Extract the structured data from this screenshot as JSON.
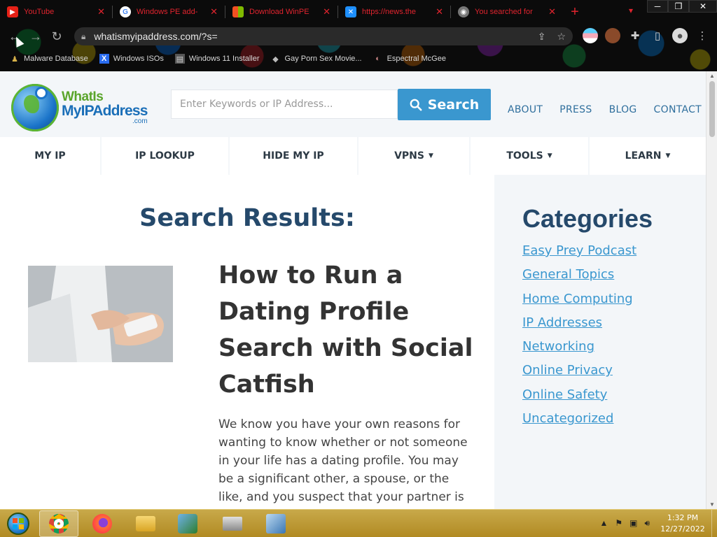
{
  "browser": {
    "tabs": [
      {
        "title": "YouTube",
        "fav_color": "#e62117",
        "fav": "▶"
      },
      {
        "title": "Windows PE add-",
        "fav_color": "#ffffff",
        "fav": "G"
      },
      {
        "title": "Download WinPE",
        "fav_color": "#f25022",
        "fav": "■"
      },
      {
        "title": "https://news.the",
        "fav_color": "#1e90ff",
        "fav": "✕"
      },
      {
        "title": "You searched for",
        "fav_color": "#888888",
        "fav": "◉"
      }
    ],
    "url": "whatismyipaddress.com/?s=",
    "bookmarks": [
      {
        "label": "Malware Database",
        "icon": "♟"
      },
      {
        "label": "Windows ISOs",
        "icon": "X"
      },
      {
        "label": "Windows 11 Installer",
        "icon": "▤"
      },
      {
        "label": "Gay Porn Sex Movie...",
        "icon": "◆"
      },
      {
        "label": "Espectral McGee",
        "icon": "◐"
      }
    ]
  },
  "site": {
    "logo": {
      "line1": "WhatIs",
      "line2": "MyIPAddress",
      "line3": ".com"
    },
    "search": {
      "placeholder": "Enter Keywords or IP Address...",
      "button": "Search"
    },
    "topnav": [
      "ABOUT",
      "PRESS",
      "BLOG",
      "CONTACT"
    ],
    "mainnav": [
      {
        "label": "MY IP",
        "dropdown": false
      },
      {
        "label": "IP LOOKUP",
        "dropdown": false
      },
      {
        "label": "HIDE MY IP",
        "dropdown": false
      },
      {
        "label": "VPNS",
        "dropdown": true
      },
      {
        "label": "TOOLS",
        "dropdown": true
      },
      {
        "label": "LEARN",
        "dropdown": true
      }
    ],
    "results_title": "Search Results:",
    "post": {
      "title": "How to Run a Dating Profile Search with Social Catfish",
      "excerpt": "We know you have your own reasons for wanting to know whether or not someone in your life has a dating profile. You may be a significant other, a spouse, or the like, and you suspect that your partner is"
    },
    "categories_title": "Categories",
    "categories": [
      "Easy Prey Podcast",
      "General Topics",
      "Home Computing",
      "IP Addresses",
      "Networking",
      "Online Privacy",
      "Online Safety",
      "Uncategorized"
    ]
  },
  "taskbar": {
    "time": "1:32 PM",
    "date": "12/27/2022"
  }
}
